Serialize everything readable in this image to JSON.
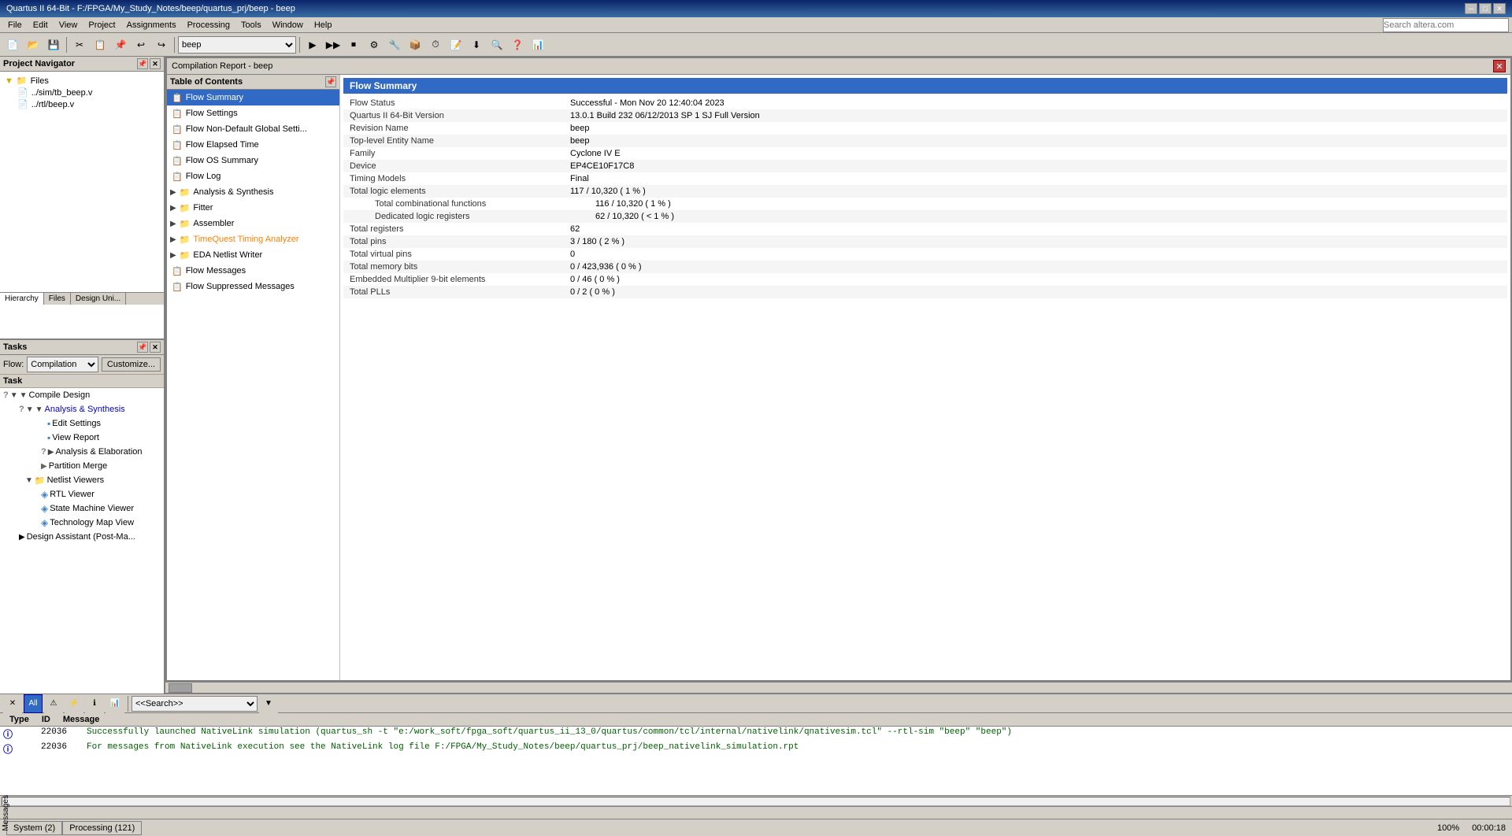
{
  "titleBar": {
    "title": "Quartus II 64-Bit - F:/FPGA/My_Study_Notes/beep/quartus_prj/beep - beep",
    "minimizeLabel": "─",
    "maximizeLabel": "□",
    "closeLabel": "✕"
  },
  "menuBar": {
    "items": [
      "File",
      "Edit",
      "View",
      "Project",
      "Assignments",
      "Processing",
      "Tools",
      "Window",
      "Help"
    ]
  },
  "toolbar": {
    "flowSelect": "beep",
    "flowSelectPlaceholder": "beep"
  },
  "projectNavigator": {
    "title": "Project Navigator",
    "files": [
      "../sim/tb_beep.v",
      "../rtl/beep.v"
    ],
    "tabs": [
      "Hierarchy",
      "Files",
      "Design Uni..."
    ]
  },
  "tasks": {
    "title": "Tasks",
    "flowLabel": "Flow:",
    "flowValue": "Compilation",
    "customizeLabel": "Customize...",
    "columnHeader": "Task",
    "items": [
      {
        "label": "Compile Design",
        "level": 0,
        "type": "folder-expand",
        "icon": "expand"
      },
      {
        "label": "Analysis & Synthesis",
        "level": 1,
        "type": "folder-expand",
        "icon": "expand",
        "highlight": false
      },
      {
        "label": "Edit Settings",
        "level": 2,
        "type": "doc",
        "icon": "doc"
      },
      {
        "label": "View Report",
        "level": 2,
        "type": "doc",
        "icon": "doc"
      },
      {
        "label": "Analysis & Elaboration",
        "level": 2,
        "type": "play",
        "icon": "play"
      },
      {
        "label": "Partition Merge",
        "level": 2,
        "type": "play",
        "icon": "play"
      },
      {
        "label": "Netlist Viewers",
        "level": 1,
        "type": "folder-expand",
        "icon": "expand"
      },
      {
        "label": "RTL Viewer",
        "level": 2,
        "type": "doc",
        "icon": "rtl"
      },
      {
        "label": "State Machine Viewer",
        "level": 2,
        "type": "doc",
        "icon": "state"
      },
      {
        "label": "Technology Map View",
        "level": 2,
        "type": "doc",
        "icon": "tech"
      },
      {
        "label": "Design Assistant (Post-Ma...",
        "level": 1,
        "type": "play",
        "icon": "play"
      }
    ]
  },
  "compilationReport": {
    "title": "Compilation Report - beep",
    "closeLabel": "✕",
    "toc": {
      "header": "Table of Contents",
      "items": [
        {
          "label": "Flow Summary",
          "level": 0,
          "selected": true,
          "type": "doc"
        },
        {
          "label": "Flow Settings",
          "level": 0,
          "type": "doc"
        },
        {
          "label": "Flow Non-Default Global Setti...",
          "level": 0,
          "type": "doc"
        },
        {
          "label": "Flow Elapsed Time",
          "level": 0,
          "type": "doc"
        },
        {
          "label": "Flow OS Summary",
          "level": 0,
          "type": "doc"
        },
        {
          "label": "Flow Log",
          "level": 0,
          "type": "doc"
        },
        {
          "label": "Analysis & Synthesis",
          "level": 0,
          "type": "folder",
          "expanded": false
        },
        {
          "label": "Fitter",
          "level": 0,
          "type": "folder",
          "expanded": false
        },
        {
          "label": "Assembler",
          "level": 0,
          "type": "folder",
          "expanded": false
        },
        {
          "label": "TimeQuest Timing Analyzer",
          "level": 0,
          "type": "folder-warn",
          "expanded": false
        },
        {
          "label": "EDA Netlist Writer",
          "level": 0,
          "type": "folder",
          "expanded": false
        },
        {
          "label": "Flow Messages",
          "level": 0,
          "type": "doc"
        },
        {
          "label": "Flow Suppressed Messages",
          "level": 0,
          "type": "doc"
        }
      ]
    },
    "flowSummary": {
      "title": "Flow Summary",
      "rows": [
        {
          "key": "Flow Status",
          "value": "Successful - Mon Nov 20 12:40:04 2023",
          "indent": 0
        },
        {
          "key": "Quartus II 64-Bit Version",
          "value": "13.0.1 Build 232 06/12/2013 SP 1 SJ Full Version",
          "indent": 0
        },
        {
          "key": "Revision Name",
          "value": "beep",
          "indent": 0
        },
        {
          "key": "Top-level Entity Name",
          "value": "beep",
          "indent": 0
        },
        {
          "key": "Family",
          "value": "Cyclone IV E",
          "indent": 0
        },
        {
          "key": "Device",
          "value": "EP4CE10F17C8",
          "indent": 0
        },
        {
          "key": "Timing Models",
          "value": "Final",
          "indent": 0
        },
        {
          "key": "Total logic elements",
          "value": "117 / 10,320 ( 1 % )",
          "indent": 0
        },
        {
          "key": "Total combinational functions",
          "value": "116 / 10,320 ( 1 % )",
          "indent": 1
        },
        {
          "key": "Dedicated logic registers",
          "value": "62 / 10,320 ( < 1 % )",
          "indent": 1
        },
        {
          "key": "Total registers",
          "value": "62",
          "indent": 0
        },
        {
          "key": "Total pins",
          "value": "3 / 180 ( 2 % )",
          "indent": 0
        },
        {
          "key": "Total virtual pins",
          "value": "0",
          "indent": 0
        },
        {
          "key": "Total memory bits",
          "value": "0 / 423,936 ( 0 % )",
          "indent": 0
        },
        {
          "key": "Embedded Multiplier 9-bit elements",
          "value": "0 / 46 ( 0 % )",
          "indent": 0
        },
        {
          "key": "Total PLLs",
          "value": "0 / 2 ( 0 % )",
          "indent": 0
        }
      ]
    }
  },
  "messages": {
    "searchPlaceholder": "<<Search>>",
    "columns": [
      "Type",
      "ID",
      "Message"
    ],
    "rows": [
      {
        "type": "info",
        "id": "22036",
        "text": "Successfully launched NativeLink simulation (quartus_sh -t \"e:/work_soft/fpga_soft/quartus_ii_13_0/quartus/common/tcl/internal/nativelink/qnativesim.tcl\" --rtl-sim \"beep\" \"beep\")"
      },
      {
        "type": "info",
        "id": "22036",
        "text": "For messages from NativeLink execution see the NativeLink log file F:/FPGA/My_Study_Notes/beep/quartus_prj/beep_nativelink_simulation.rpt"
      }
    ]
  },
  "statusBar": {
    "tabs": [
      "System (2)",
      "Processing (121)"
    ],
    "zoom": "100%",
    "time": "00:00:18"
  }
}
